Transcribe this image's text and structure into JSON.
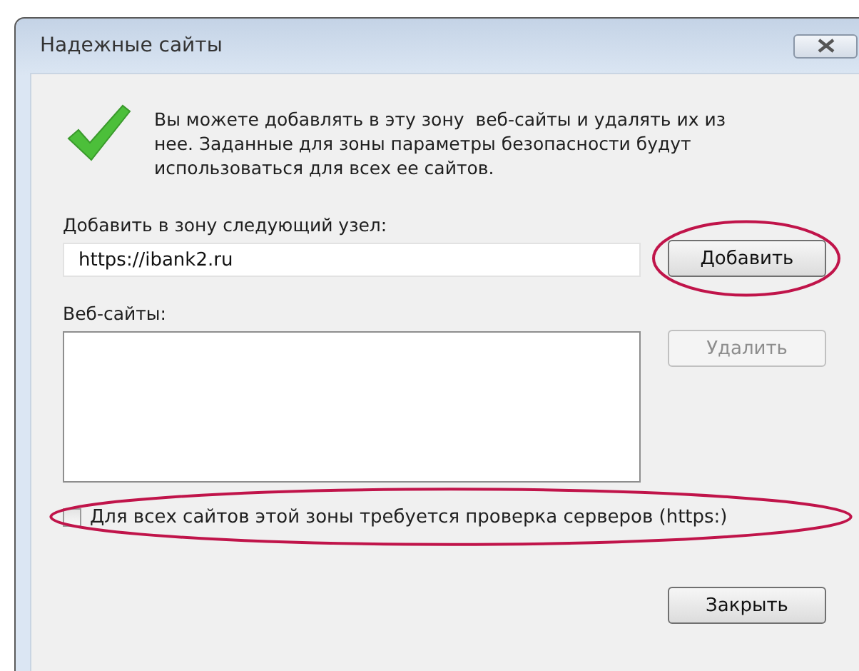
{
  "window": {
    "title": "Надежные сайты"
  },
  "info_text": "Вы можете добавлять в эту зону  веб-сайты и удалять их из нее. Заданные для зоны параметры безопасности будут использоваться для всех ее сайтов.",
  "add_label": "Добавить в зону следующий узел:",
  "add_field": {
    "value": "https://ibank2.ru"
  },
  "add_button": {
    "label": "Добавить",
    "disabled": false,
    "highlighted": true
  },
  "websites_label": "Веб-сайты:",
  "remove_button": {
    "label": "Удалить",
    "disabled": true
  },
  "https_checkbox": {
    "label": "Для всех сайтов этой зоны требуется проверка серверов (https:)",
    "checked": false,
    "highlighted": true
  },
  "close_button": {
    "label": "Закрыть",
    "disabled": false
  }
}
